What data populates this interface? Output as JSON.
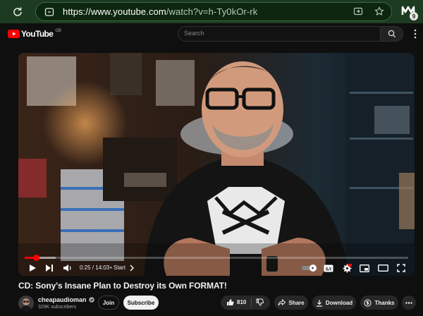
{
  "browser": {
    "url_host": "https://www.youtube.com",
    "url_path": "/watch?v=h-Ty0kOr-rk",
    "extension_badge": "9"
  },
  "masthead": {
    "logo_text": "YouTube",
    "region": "GB",
    "search_placeholder": "Search"
  },
  "player": {
    "current_time": "0:25 / 14:03",
    "chapter": "• Start",
    "progress": 0.03,
    "buffered": 0.08
  },
  "video": {
    "title": "CD: Sony's Insane Plan to Destroy its Own FORMAT!",
    "channel": "cheapaudioman",
    "subscribers": "329K subscribers",
    "join_label": "Join",
    "subscribe_label": "Subscribe",
    "likes": "810",
    "share_label": "Share",
    "download_label": "Download",
    "thanks_label": "Thanks"
  },
  "colors": {
    "accent": "#ff0000",
    "browser_bar": "#1d3b20"
  }
}
